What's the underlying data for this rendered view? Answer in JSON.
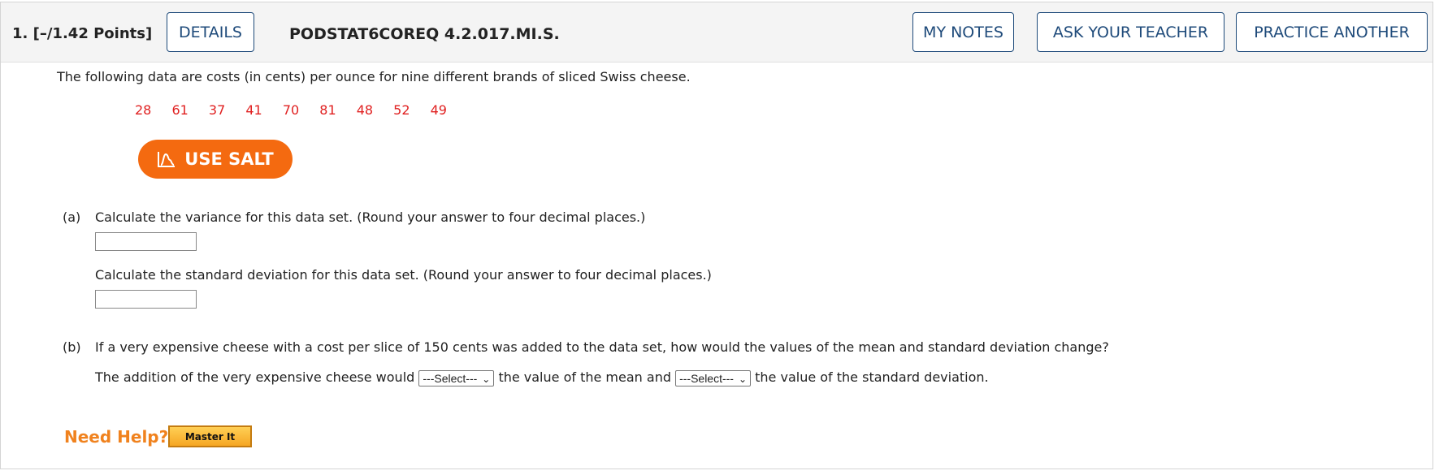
{
  "header": {
    "question_number": "1. [–/1.42 Points]",
    "details_label": "DETAILS",
    "problem_code": "PODSTAT6COREQ 4.2.017.MI.S.",
    "my_notes_label": "MY NOTES",
    "ask_teacher_label": "ASK YOUR TEACHER",
    "practice_another_label": "PRACTICE ANOTHER"
  },
  "intro": "The following data are costs (in cents) per ounce for nine different brands of sliced Swiss cheese.",
  "data_values": [
    "28",
    "61",
    "37",
    "41",
    "70",
    "81",
    "48",
    "52",
    "49"
  ],
  "salt_button": {
    "label": "USE SALT",
    "icon": "salt-chart-icon"
  },
  "part_a": {
    "label": "(a)",
    "variance_prompt": "Calculate the variance for this data set. (Round your answer to four decimal places.)",
    "variance_value": "",
    "sd_prompt": "Calculate the standard deviation for this data set. (Round your answer to four decimal places.)",
    "sd_value": ""
  },
  "part_b": {
    "label": "(b)",
    "question": "If a very expensive cheese with a cost per slice of 150 cents was added to the data set, how would the values of the mean and standard deviation change?",
    "sentence_start": "The addition of the very expensive cheese would",
    "select_mean": "---Select---",
    "sentence_mid": "the value of the mean and",
    "select_sd": "---Select---",
    "sentence_end": "the value of the standard deviation."
  },
  "help": {
    "need_help": "Need Help?",
    "master_it": "Master It"
  },
  "colors": {
    "header_bg": "#f4f4f4",
    "button_border": "#1e4a7a",
    "data_red": "#e02020",
    "salt_orange": "#f46a10",
    "need_help_orange": "#f0821e"
  }
}
